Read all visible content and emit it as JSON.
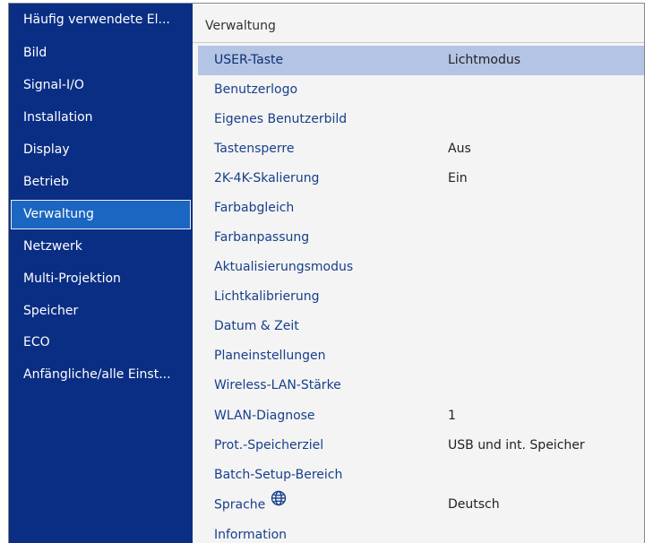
{
  "sidebar": {
    "items": [
      {
        "label": "Häufig verwendete El..."
      },
      {
        "label": "Bild"
      },
      {
        "label": "Signal-I/O"
      },
      {
        "label": "Installation"
      },
      {
        "label": "Display"
      },
      {
        "label": "Betrieb"
      },
      {
        "label": "Verwaltung",
        "active": true
      },
      {
        "label": "Netzwerk"
      },
      {
        "label": "Multi-Projektion"
      },
      {
        "label": "Speicher"
      },
      {
        "label": "ECO"
      },
      {
        "label": "Anfängliche/alle Einst..."
      }
    ]
  },
  "main": {
    "title": "Verwaltung",
    "rows": [
      {
        "label": "USER-Taste",
        "value": "Lichtmodus"
      },
      {
        "label": "Benutzerlogo",
        "value": ""
      },
      {
        "label": "Eigenes Benutzerbild",
        "value": ""
      },
      {
        "label": "Tastensperre",
        "value": "Aus"
      },
      {
        "label": "2K-4K-Skalierung",
        "value": "Ein"
      },
      {
        "label": "Farbabgleich",
        "value": ""
      },
      {
        "label": "Farbanpassung",
        "value": ""
      },
      {
        "label": "Aktualisierungsmodus",
        "value": ""
      },
      {
        "label": "Lichtkalibrierung",
        "value": ""
      },
      {
        "label": "Datum & Zeit",
        "value": ""
      },
      {
        "label": "Planeinstellungen",
        "value": ""
      },
      {
        "label": "Wireless-LAN-Stärke",
        "value": ""
      },
      {
        "label": "WLAN-Diagnose",
        "value": "1"
      },
      {
        "label": "Prot.-Speicherziel",
        "value": "USB und int. Speicher"
      },
      {
        "label": "Batch-Setup-Bereich",
        "value": ""
      },
      {
        "label": "Sprache",
        "value": "Deutsch",
        "icon": "globe-icon"
      },
      {
        "label": "Information",
        "value": ""
      }
    ]
  },
  "colors": {
    "sidebar_bg": "#0a2e84",
    "sidebar_active": "#1a66c0",
    "row_highlight": "#b4c4e4",
    "menu_text": "#173f8a"
  }
}
